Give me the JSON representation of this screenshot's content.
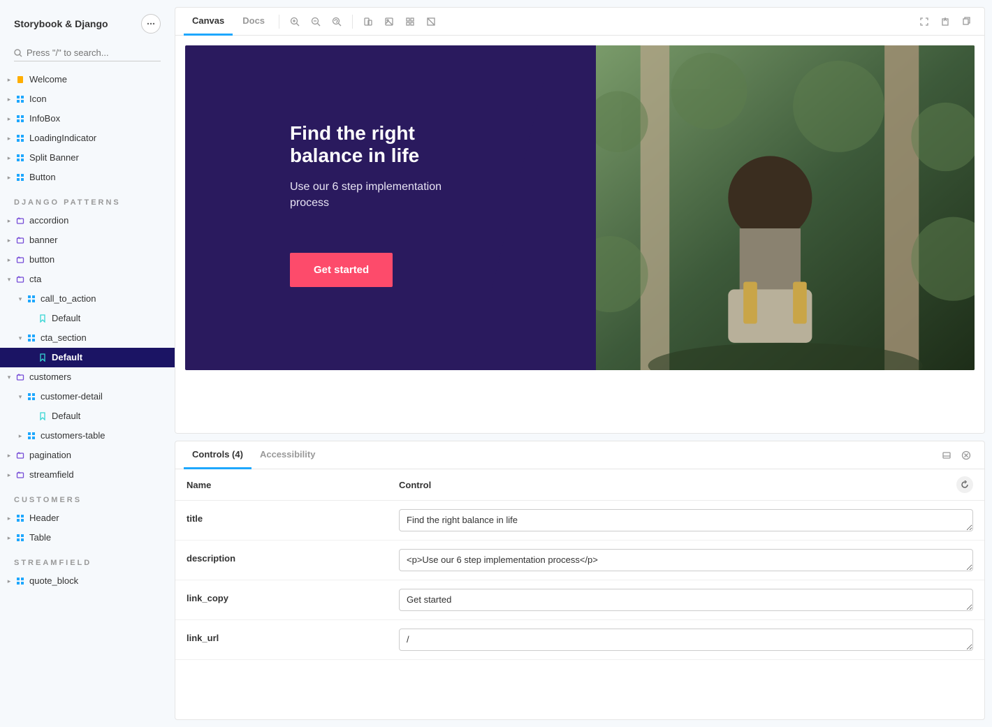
{
  "app_title": "Storybook & Django",
  "search_placeholder": "Press \"/\" to search...",
  "toolbar": {
    "tabs": {
      "canvas": "Canvas",
      "docs": "Docs"
    }
  },
  "sidebar": {
    "top_items": [
      {
        "label": "Welcome",
        "icon": "doc"
      },
      {
        "label": "Icon",
        "icon": "component"
      },
      {
        "label": "InfoBox",
        "icon": "component"
      },
      {
        "label": "LoadingIndicator",
        "icon": "component"
      },
      {
        "label": "Split Banner",
        "icon": "component"
      },
      {
        "label": "Button",
        "icon": "component"
      }
    ],
    "sections": [
      {
        "header": "DJANGO PATTERNS",
        "items": [
          {
            "label": "accordion",
            "icon": "folder",
            "depth": 0,
            "caret": "right"
          },
          {
            "label": "banner",
            "icon": "folder",
            "depth": 0,
            "caret": "right"
          },
          {
            "label": "button",
            "icon": "folder",
            "depth": 0,
            "caret": "right"
          },
          {
            "label": "cta",
            "icon": "folder",
            "depth": 0,
            "caret": "down"
          },
          {
            "label": "call_to_action",
            "icon": "component",
            "depth": 1,
            "caret": "down"
          },
          {
            "label": "Default",
            "icon": "story",
            "depth": 2
          },
          {
            "label": "cta_section",
            "icon": "component",
            "depth": 1,
            "caret": "down"
          },
          {
            "label": "Default",
            "icon": "story",
            "depth": 2,
            "selected": true,
            "bold": true
          },
          {
            "label": "customers",
            "icon": "folder",
            "depth": 0,
            "caret": "down"
          },
          {
            "label": "customer-detail",
            "icon": "component",
            "depth": 1,
            "caret": "down"
          },
          {
            "label": "Default",
            "icon": "story",
            "depth": 2
          },
          {
            "label": "customers-table",
            "icon": "component",
            "depth": 1,
            "caret": "right"
          },
          {
            "label": "pagination",
            "icon": "folder",
            "depth": 0,
            "caret": "right"
          },
          {
            "label": "streamfield",
            "icon": "folder",
            "depth": 0,
            "caret": "right"
          }
        ]
      },
      {
        "header": "CUSTOMERS",
        "items": [
          {
            "label": "Header",
            "icon": "component",
            "depth": 0,
            "caret": "right"
          },
          {
            "label": "Table",
            "icon": "component",
            "depth": 0,
            "caret": "right"
          }
        ]
      },
      {
        "header": "STREAMFIELD",
        "items": [
          {
            "label": "quote_block",
            "icon": "component",
            "depth": 0,
            "caret": "right"
          }
        ]
      }
    ]
  },
  "preview": {
    "title": "Find the right balance in life",
    "description": "Use our 6 step implementation process",
    "button": "Get started"
  },
  "addons": {
    "tabs": {
      "controls": "Controls (4)",
      "accessibility": "Accessibility"
    },
    "columns": {
      "name": "Name",
      "control": "Control"
    },
    "rows": [
      {
        "name": "title",
        "value": "Find the right balance in life"
      },
      {
        "name": "description",
        "value": "<p>Use our 6 step implementation process</p>"
      },
      {
        "name": "link_copy",
        "value": "Get started"
      },
      {
        "name": "link_url",
        "value": "/"
      }
    ]
  }
}
